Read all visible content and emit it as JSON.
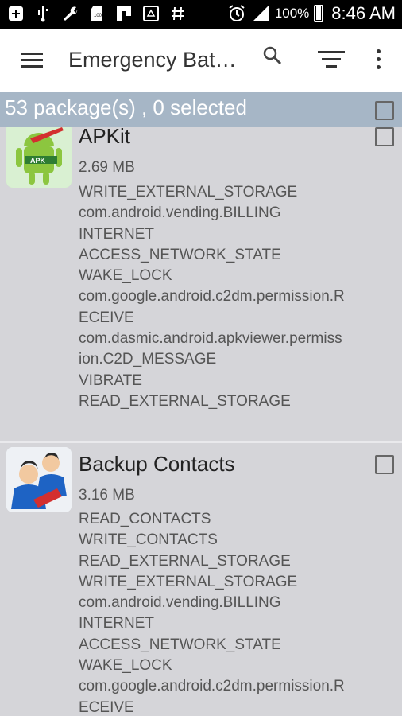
{
  "status_bar": {
    "battery_percent": "100%",
    "time": "8:46 AM",
    "left_icons": [
      "add-box-icon",
      "usb-icon",
      "wrench-icon",
      "sd-card-icon",
      "flipboard-icon",
      "recycle-icon",
      "hash-icon"
    ],
    "right_icons": [
      "alarm-icon",
      "signal-icon",
      "battery-icon"
    ]
  },
  "app_bar": {
    "title": "Emergency Bat…",
    "icons": [
      "menu-icon",
      "search-icon",
      "filter-icon",
      "more-vert-icon"
    ]
  },
  "summary": {
    "text": "53 package(s) , 0 selected"
  },
  "packages": [
    {
      "name": "APKit",
      "size": "2.69 MB",
      "icon": "apkit-android-icon",
      "permissions": [
        "WRITE_EXTERNAL_STORAGE",
        "com.android.vending.BILLING",
        "INTERNET",
        "ACCESS_NETWORK_STATE",
        "WAKE_LOCK",
        "com.google.android.c2dm.permission.R",
        "ECEIVE",
        "com.dasmic.android.apkviewer.permiss",
        "ion.C2D_MESSAGE",
        "VIBRATE",
        "READ_EXTERNAL_STORAGE"
      ]
    },
    {
      "name": "Backup Contacts",
      "size": "3.16 MB",
      "icon": "backup-contacts-icon",
      "permissions": [
        "READ_CONTACTS",
        "WRITE_CONTACTS",
        "READ_EXTERNAL_STORAGE",
        "WRITE_EXTERNAL_STORAGE",
        "com.android.vending.BILLING",
        "INTERNET",
        "ACCESS_NETWORK_STATE",
        "WAKE_LOCK",
        "com.google.android.c2dm.permission.R",
        "ECEIVE"
      ]
    }
  ],
  "colors": {
    "status_bar": "#000000",
    "app_bar": "#ffffff",
    "summary_bar": "#a6b6c6",
    "list_bg": "#d5d5d9"
  }
}
